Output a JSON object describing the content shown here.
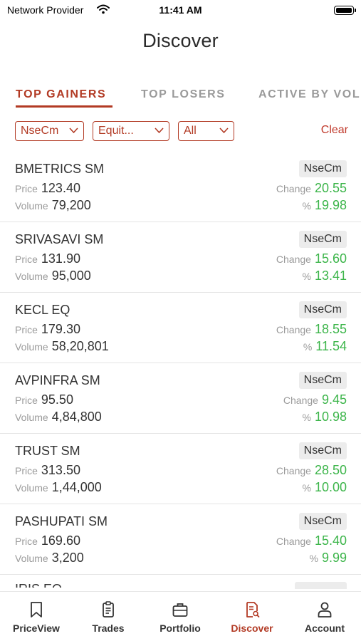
{
  "status_bar": {
    "carrier": "Network Provider",
    "time": "11:41 AM"
  },
  "header": {
    "title": "Discover"
  },
  "tabs": [
    {
      "label": "TOP GAINERS",
      "active": true
    },
    {
      "label": "TOP LOSERS",
      "active": false
    },
    {
      "label": "ACTIVE BY VOLUME",
      "active": false
    }
  ],
  "filters": {
    "items": [
      {
        "label": "NseCm"
      },
      {
        "label": "Equit..."
      },
      {
        "label": "All"
      }
    ],
    "clear_label": "Clear"
  },
  "list": {
    "price_label": "Price",
    "volume_label": "Volume",
    "change_label": "Change",
    "pct_label": "%",
    "rows": [
      {
        "symbol": "BMETRICS SM",
        "exchange": "NseCm",
        "price": "123.40",
        "volume": "79,200",
        "change": "20.55",
        "pct": "19.98"
      },
      {
        "symbol": "SRIVASAVI SM",
        "exchange": "NseCm",
        "price": "131.90",
        "volume": "95,000",
        "change": "15.60",
        "pct": "13.41"
      },
      {
        "symbol": "KECL EQ",
        "exchange": "NseCm",
        "price": "179.30",
        "volume": "58,20,801",
        "change": "18.55",
        "pct": "11.54"
      },
      {
        "symbol": "AVPINFRA SM",
        "exchange": "NseCm",
        "price": "95.50",
        "volume": "4,84,800",
        "change": "9.45",
        "pct": "10.98"
      },
      {
        "symbol": "TRUST SM",
        "exchange": "NseCm",
        "price": "313.50",
        "volume": "1,44,000",
        "change": "28.50",
        "pct": "10.00"
      },
      {
        "symbol": "PASHUPATI SM",
        "exchange": "NseCm",
        "price": "169.60",
        "volume": "3,200",
        "change": "15.40",
        "pct": "9.99"
      }
    ],
    "partial_row": {
      "symbol": "IRIS EQ",
      "exchange": "NseCm"
    }
  },
  "bottom_nav": [
    {
      "label": "PriceView",
      "icon": "bookmark-icon",
      "active": false
    },
    {
      "label": "Trades",
      "icon": "clipboard-icon",
      "active": false
    },
    {
      "label": "Portfolio",
      "icon": "briefcase-icon",
      "active": false
    },
    {
      "label": "Discover",
      "icon": "document-search-icon",
      "active": true
    },
    {
      "label": "Account",
      "icon": "person-icon",
      "active": false
    }
  ],
  "colors": {
    "accent": "#b23a24",
    "positive": "#3cb54a",
    "muted": "#9a9a9a"
  }
}
